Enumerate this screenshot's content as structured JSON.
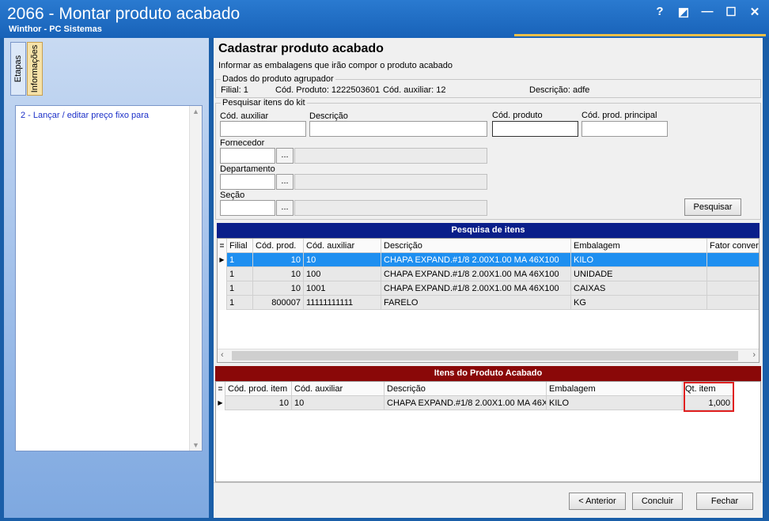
{
  "window": {
    "title": "2066 - Montar produto acabado",
    "subtitle": "Winthor - PC Sistemas",
    "controls": [
      "?",
      "◩",
      "—",
      "☐",
      "✕"
    ]
  },
  "left": {
    "tabs": [
      "Etapas",
      "Informações"
    ],
    "items": [
      "2 - Lançar / editar preço fixo para"
    ]
  },
  "main": {
    "title": "Cadastrar produto acabado",
    "subtitle": "Informar as embalagens que irão compor o produto acabado",
    "agrupador": {
      "legend": "Dados do produto agrupador",
      "filial": "Filial: 1",
      "cod_produto": "Cód. Produto: 1222503601",
      "cod_auxiliar": "Cód. auxiliar:  12",
      "descricao": "Descrição: adfe"
    },
    "search": {
      "legend": "Pesquisar itens do kit",
      "cod_auxiliar_label": "Cód. auxiliar",
      "descricao_label": "Descrição",
      "cod_produto_label": "Cód. produto",
      "cod_prod_principal_label": "Cód. prod. principal",
      "fornecedor_label": "Fornecedor",
      "departamento_label": "Departamento",
      "secao_label": "Seção",
      "dots_label": "...",
      "pesquisar_label": "Pesquisar"
    },
    "pesquisa_grid": {
      "title": "Pesquisa de itens",
      "header_color": "#0a1f8a",
      "columns": [
        "Filial",
        "Cód. prod.",
        "Cód. auxiliar",
        "Descrição",
        "Embalagem",
        "Fator conver"
      ],
      "rows": [
        [
          "1",
          "10",
          "10",
          "CHAPA  EXPAND.#1/8 2.00X1.00 MA 46X100",
          "KILO",
          ""
        ],
        [
          "1",
          "10",
          "100",
          "CHAPA  EXPAND.#1/8 2.00X1.00 MA 46X100",
          "UNIDADE",
          ""
        ],
        [
          "1",
          "10",
          "1001",
          "CHAPA  EXPAND.#1/8 2.00X1.00 MA 46X100",
          "CAIXAS",
          ""
        ],
        [
          "1",
          "800007",
          "11111111111",
          "FARELO",
          "KG",
          ""
        ]
      ]
    },
    "itens_grid": {
      "title": "Itens do Produto Acabado",
      "header_color": "#8a0808",
      "columns": [
        "Cód. prod. item",
        "Cód. auxiliar",
        "Descrição",
        "Embalagem",
        "Qt. item"
      ],
      "rows": [
        [
          "10",
          "10",
          "CHAPA  EXPAND.#1/8 2.00X1.00 MA 46X",
          "KILO",
          "1,000"
        ]
      ]
    },
    "buttons": {
      "anterior": "< Anterior",
      "concluir": "Concluir",
      "fechar": "Fechar"
    }
  }
}
